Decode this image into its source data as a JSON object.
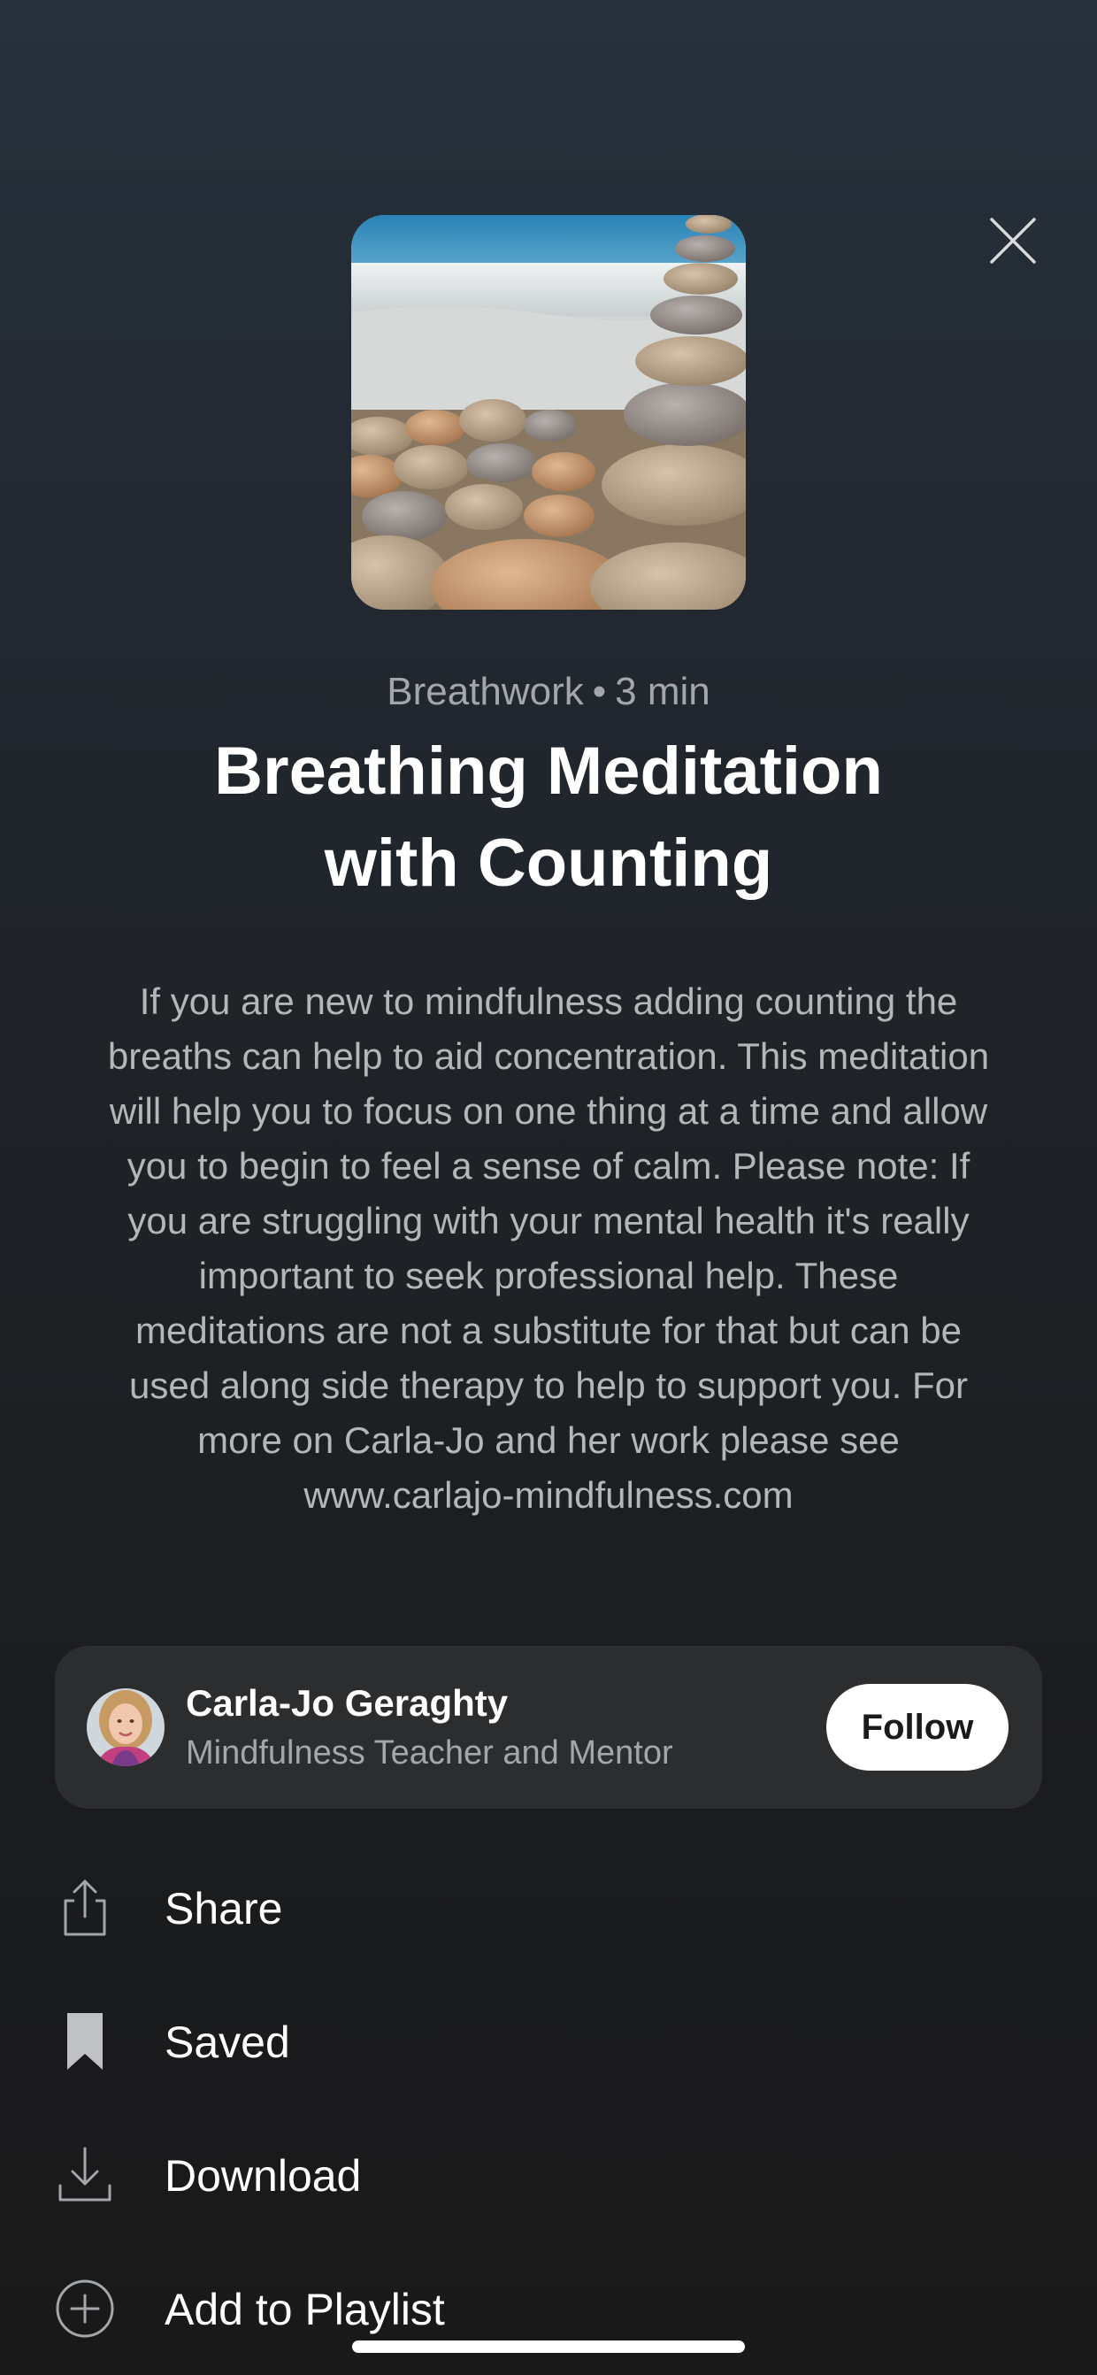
{
  "header": {
    "close_icon": "close-icon"
  },
  "session": {
    "cover_image": "stacked-pebbles-beach-image",
    "category": "Breathwork",
    "separator": "•",
    "duration": "3 min",
    "title_line1": "Breathing Meditation",
    "title_line2": "with Counting",
    "description": "If you are new to mindfulness adding counting the breaths can help to aid concentration. This meditation will help you to focus on one thing at a time and allow you to begin to feel a sense of calm. Please note: If you are struggling with your mental health it's really important to seek professional help. These meditations are not a substitute for that but can be used along side therapy to help to support you. For more on Carla-Jo and her work please see www.carlajo-mindfulness.com"
  },
  "author": {
    "name": "Carla-Jo Geraghty",
    "role": "Mindfulness Teacher and Mentor",
    "follow_label": "Follow"
  },
  "actions": [
    {
      "icon": "share-icon",
      "label": "Share"
    },
    {
      "icon": "bookmark-icon",
      "label": "Saved"
    },
    {
      "icon": "download-icon",
      "label": "Download"
    },
    {
      "icon": "add-circle-icon",
      "label": "Add to Playlist"
    }
  ],
  "colors": {
    "background_top": "#27313c",
    "background_bottom": "#19191a",
    "card": "#2c2d2f",
    "secondary_text": "#a3a6aa",
    "follow_button": "#ffffff"
  }
}
